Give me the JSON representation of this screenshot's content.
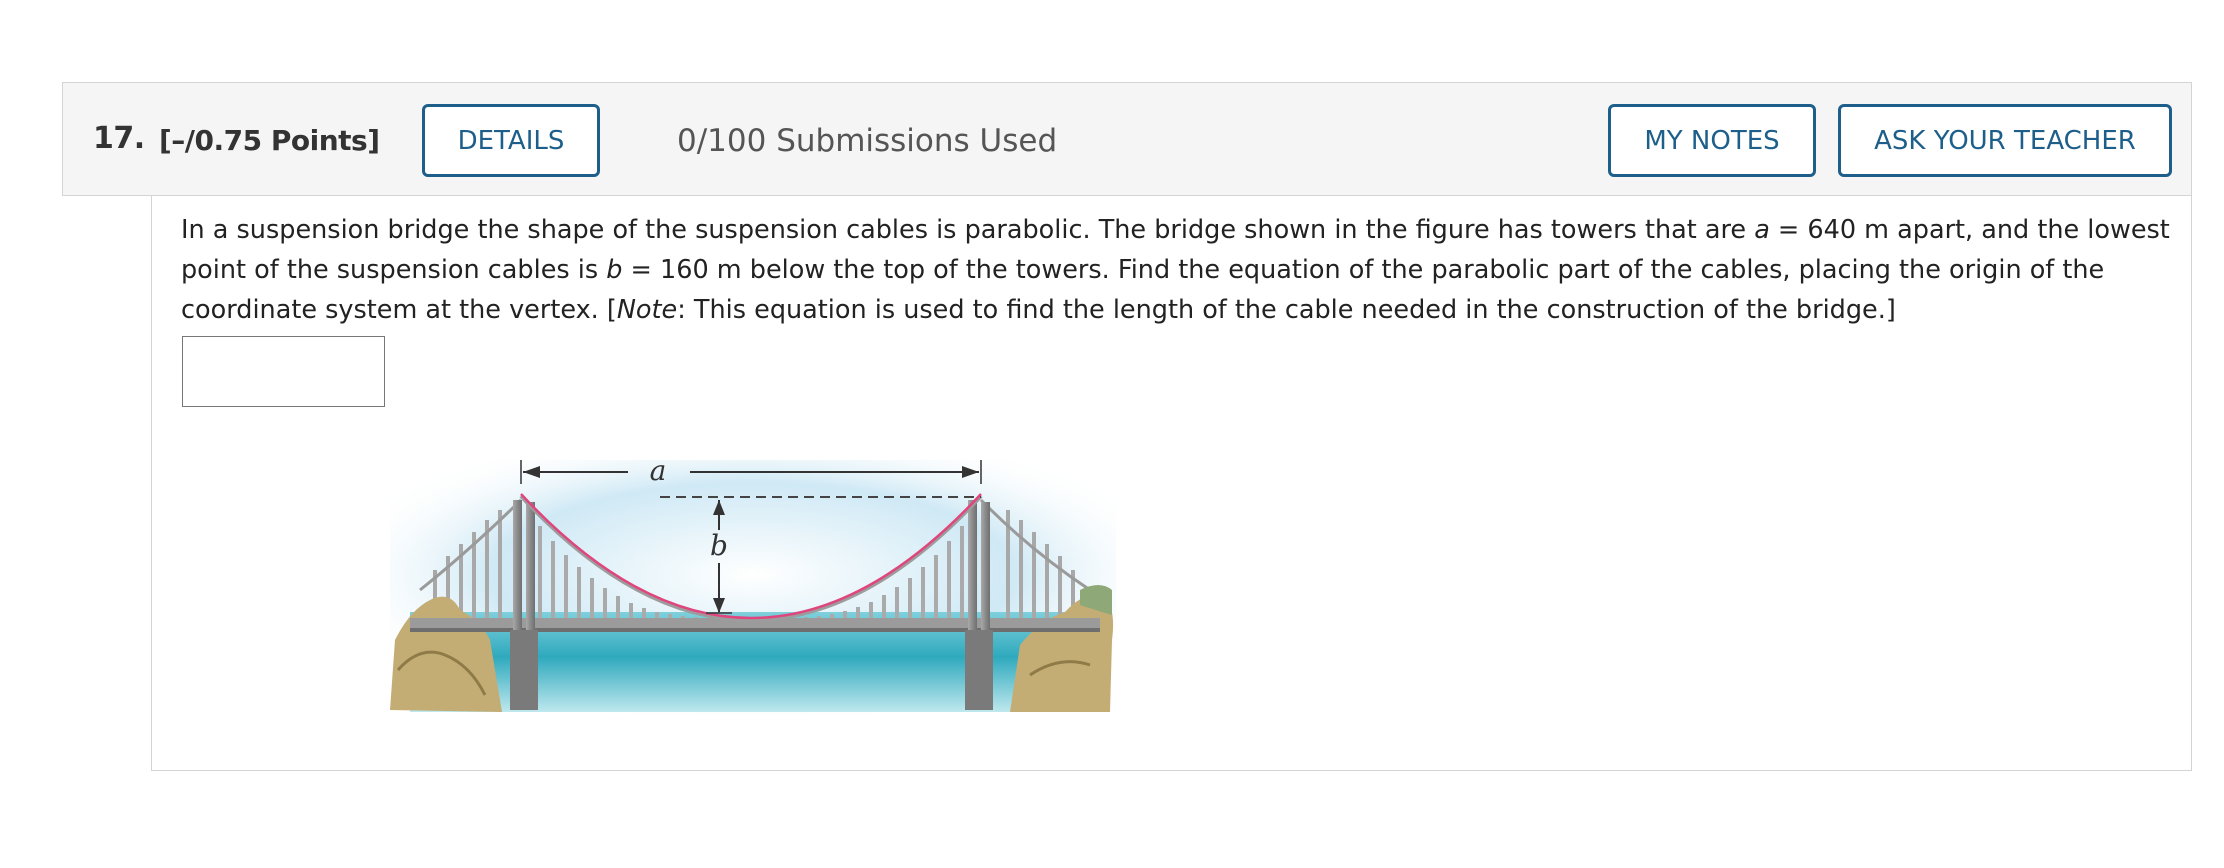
{
  "question": {
    "number": "17.",
    "points": "[–/0.75 Points]",
    "details_label": "DETAILS",
    "submissions": "0/100 Submissions Used",
    "my_notes_label": "MY NOTES",
    "ask_teacher_label": "ASK YOUR TEACHER",
    "text": {
      "p1": "In a suspension bridge the shape of the suspension cables is parabolic. The bridge shown in the figure has towers that are ",
      "a_var": "a",
      "p2": " = 640 m apart, and the lowest point of the suspension cables is ",
      "b_var": "b",
      "p3": " = 160 m below the top of the towers. Find the equation of the parabolic part of the cables, placing the origin of the coordinate system at the vertex. [",
      "note": "Note",
      "p4": ": This equation is used to find the length of the cable needed in the construction of the bridge.]"
    },
    "answer_value": ""
  },
  "figure": {
    "label_a": "a",
    "label_b": "b",
    "colors": {
      "sky": "#c9e6f4",
      "water": "#3fb3c4",
      "tower": "#8c8c8c",
      "cable": "#e0457e",
      "rock": "#c8b27a"
    }
  }
}
